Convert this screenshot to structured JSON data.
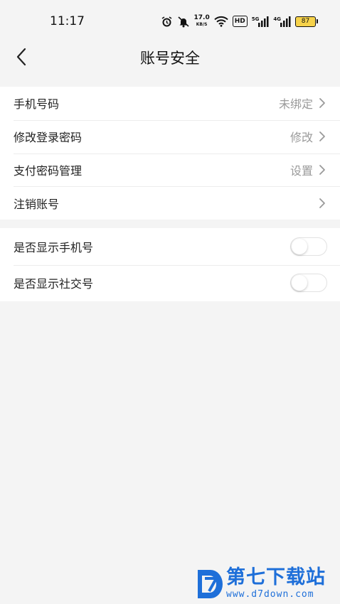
{
  "status_bar": {
    "time": "11:17",
    "net_speed_value": "17.0",
    "net_speed_unit": "KB/S",
    "hd_label": "HD",
    "signal1_label": "5G",
    "signal2_label": "4G",
    "battery_level": "87",
    "battery_color": "#f6d24a"
  },
  "nav": {
    "title": "账号安全"
  },
  "security_list": [
    {
      "label": "手机号码",
      "value": "未绑定"
    },
    {
      "label": "修改登录密码",
      "value": "修改"
    },
    {
      "label": "支付密码管理",
      "value": "设置"
    },
    {
      "label": "注销账号",
      "value": ""
    }
  ],
  "privacy_list": [
    {
      "label": "是否显示手机号",
      "enabled": false
    },
    {
      "label": "是否显示社交号",
      "enabled": false
    }
  ],
  "watermark": {
    "brand": "第七下载站",
    "url": "www.d7down.com",
    "color": "#1e6fd9"
  },
  "icons": [
    "alarm-icon",
    "mute-icon",
    "wifi-icon",
    "signal-icon",
    "battery-icon",
    "back-arrow-icon",
    "chevron-right-icon"
  ]
}
